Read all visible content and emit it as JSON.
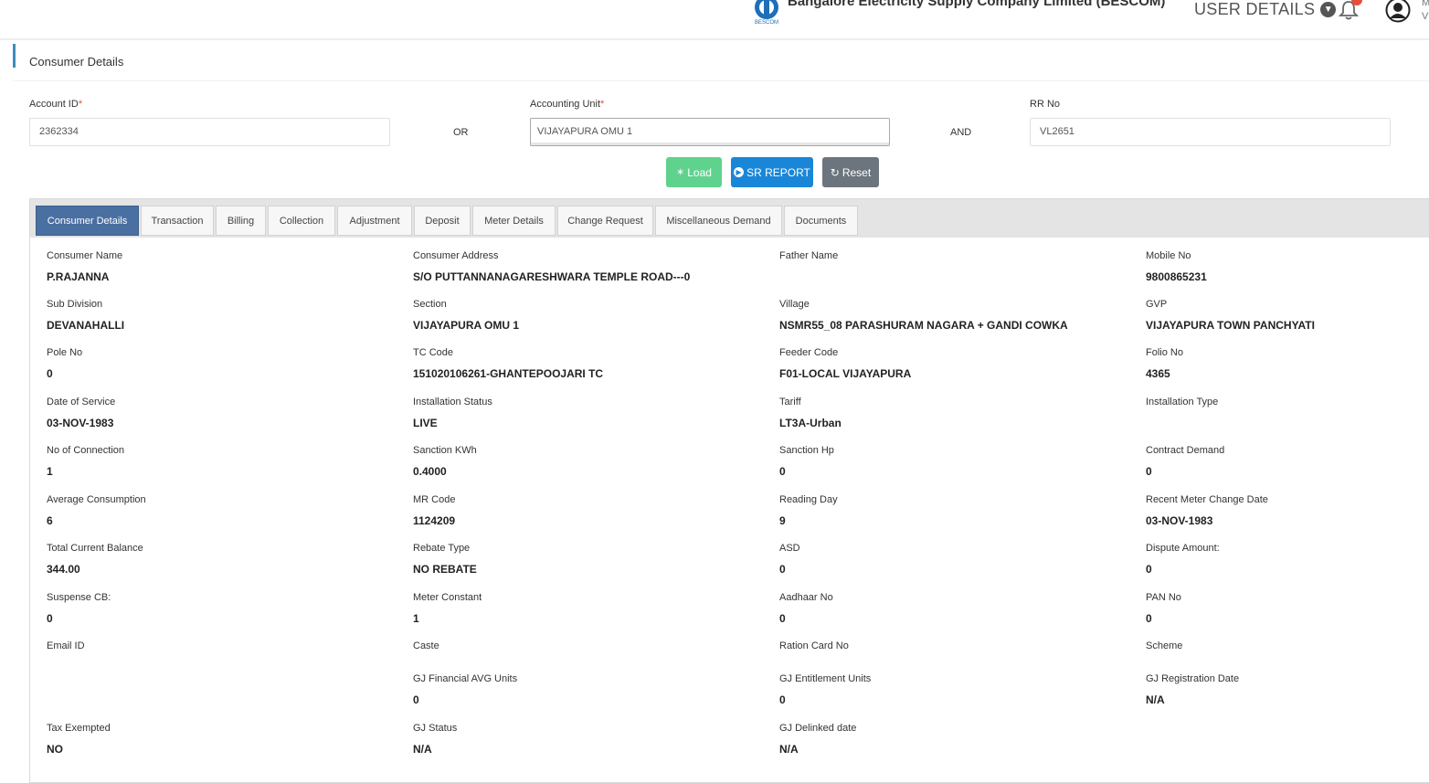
{
  "header": {
    "company": "Bangalore Electricity Supply Company Limited (BESCOM)",
    "logo_text": "BESCOM",
    "user_details": "USER DETAILS",
    "edge_text_1": "M",
    "edge_text_2": "V"
  },
  "section": {
    "title": "Consumer Details"
  },
  "form": {
    "account_id_label": "Account ID",
    "account_id_value": "2362334",
    "or": "OR",
    "accounting_unit_label": "Accounting Unit",
    "accounting_unit_value": "VIJAYAPURA OMU 1",
    "and": "AND",
    "rr_no_label": "RR No",
    "rr_no_value": "VL2651",
    "required_mark": "*"
  },
  "buttons": {
    "load": "Load",
    "sr_report": "SR REPORT",
    "reset": "Reset"
  },
  "tabs": [
    "Consumer Details",
    "Transaction",
    "Billing",
    "Collection",
    "Adjustment",
    "Deposit",
    "Meter Details",
    "Change Request",
    "Miscellaneous Demand",
    "Documents"
  ],
  "details": [
    [
      {
        "label": "Consumer Name",
        "value": "P.RAJANNA"
      },
      {
        "label": "Consumer Address",
        "value": "S/O PUTTANNANAGARESHWARA TEMPLE ROAD---0"
      },
      {
        "label": "Father Name",
        "value": ""
      },
      {
        "label": "Mobile No",
        "value": "9800865231"
      }
    ],
    [
      {
        "label": "Sub Division",
        "value": "DEVANAHALLI"
      },
      {
        "label": "Section",
        "value": "VIJAYAPURA OMU 1"
      },
      {
        "label": "Village",
        "value": "NSMR55_08 PARASHURAM NAGARA + GANDI COWKA"
      },
      {
        "label": "GVP",
        "value": "VIJAYAPURA TOWN PANCHYATI"
      }
    ],
    [
      {
        "label": "Pole No",
        "value": "0"
      },
      {
        "label": "TC Code",
        "value": "151020106261-GHANTEPOOJARI TC"
      },
      {
        "label": "Feeder Code",
        "value": "F01-LOCAL VIJAYAPURA"
      },
      {
        "label": "Folio No",
        "value": "4365"
      }
    ],
    [
      {
        "label": "Date of Service",
        "value": "03-NOV-1983"
      },
      {
        "label": "Installation Status",
        "value": "LIVE"
      },
      {
        "label": "Tariff",
        "value": "LT3A-Urban"
      },
      {
        "label": "Installation Type",
        "value": ""
      }
    ],
    [
      {
        "label": "No of Connection",
        "value": "1"
      },
      {
        "label": "Sanction KWh",
        "value": "0.4000"
      },
      {
        "label": "Sanction Hp",
        "value": "0"
      },
      {
        "label": "Contract Demand",
        "value": "0"
      }
    ],
    [
      {
        "label": "Average Consumption",
        "value": "6"
      },
      {
        "label": "MR Code",
        "value": "1124209"
      },
      {
        "label": "Reading Day",
        "value": "9"
      },
      {
        "label": "Recent Meter Change Date",
        "value": "03-NOV-1983"
      }
    ],
    [
      {
        "label": "Total Current Balance",
        "value": "344.00"
      },
      {
        "label": "Rebate Type",
        "value": "NO REBATE"
      },
      {
        "label": "ASD",
        "value": "0"
      },
      {
        "label": "Dispute Amount:",
        "value": "0"
      }
    ],
    [
      {
        "label": "Suspense CB:",
        "value": "0"
      },
      {
        "label": "Meter Constant",
        "value": "1"
      },
      {
        "label": "Aadhaar No",
        "value": "0"
      },
      {
        "label": "PAN No",
        "value": "0"
      }
    ],
    [
      {
        "label": "Email ID",
        "value": ""
      },
      {
        "label": "Caste",
        "value": ""
      },
      {
        "label": "Ration Card No",
        "value": ""
      },
      {
        "label": "Scheme",
        "value": ""
      }
    ],
    [
      {
        "label": "",
        "value": ""
      },
      {
        "label": "GJ Financial AVG Units",
        "value": "0"
      },
      {
        "label": "GJ Entitlement Units",
        "value": "0"
      },
      {
        "label": "GJ Registration Date",
        "value": "N/A"
      }
    ],
    [
      {
        "label": "Tax Exempted",
        "value": "NO"
      },
      {
        "label": "GJ Status",
        "value": "N/A"
      },
      {
        "label": "GJ Delinked date",
        "value": "N/A"
      },
      {
        "label": "",
        "value": ""
      }
    ]
  ]
}
